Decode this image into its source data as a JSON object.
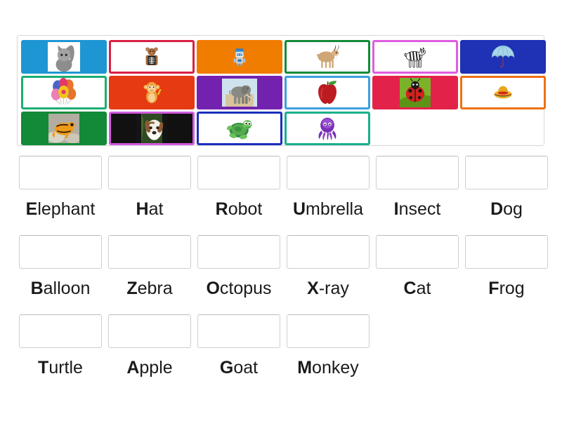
{
  "activity": {
    "type": "match-up",
    "title": "Alphabet picture and word match-up"
  },
  "image_tray": {
    "rows": [
      [
        {
          "id": "cat",
          "label": "cat picture",
          "bg": "#1e96d4",
          "border": "#1e96d4",
          "art": "cat",
          "art_bg": "#ffffff",
          "art_w": 46,
          "art_h": 48
        },
        {
          "id": "xray",
          "label": "x-ray picture",
          "bg": "#ffffff",
          "border": "#d91f45",
          "art": "xray",
          "art_bg": "#ffffff",
          "art_w": 30,
          "art_h": 44
        },
        {
          "id": "robot",
          "label": "robot picture",
          "bg": "#f07c00",
          "border": "#f07c00",
          "art": "robot",
          "art_bg": "#f07c00",
          "art_w": 28,
          "art_h": 42
        },
        {
          "id": "goat",
          "label": "goat picture",
          "bg": "#ffffff",
          "border": "#128a38",
          "art": "goat",
          "art_bg": "#ffffff",
          "art_w": 48,
          "art_h": 40
        },
        {
          "id": "zebra",
          "label": "zebra picture",
          "bg": "#ffffff",
          "border": "#e05ce0",
          "art": "zebra",
          "art_bg": "#ffffff",
          "art_w": 48,
          "art_h": 38
        },
        {
          "id": "umbrella",
          "label": "umbrella picture",
          "bg": "#1f31b4",
          "border": "#1f31b4",
          "art": "umbrella",
          "art_bg": "#1f31b4",
          "art_w": 56,
          "art_h": 36
        }
      ],
      [
        {
          "id": "balloon",
          "label": "balloon picture",
          "bg": "#ffffff",
          "border": "#1bae74",
          "art": "balloon",
          "art_bg": "#ffffff",
          "art_w": 44,
          "art_h": 44
        },
        {
          "id": "monkey",
          "label": "monkey picture",
          "bg": "#e53a12",
          "border": "#e53a12",
          "art": "monkey",
          "art_bg": "#e53a12",
          "art_w": 36,
          "art_h": 42
        },
        {
          "id": "elephant",
          "label": "elephant picture",
          "bg": "#7322b0",
          "border": "#7322b0",
          "art": "elephant",
          "art_bg": "#cfe3ef",
          "art_w": 50,
          "art_h": 40
        },
        {
          "id": "apple",
          "label": "apple picture",
          "bg": "#ffffff",
          "border": "#3aa0df",
          "art": "apple",
          "art_bg": "#ffffff",
          "art_w": 38,
          "art_h": 42
        },
        {
          "id": "insect",
          "label": "insect picture",
          "bg": "#e3224a",
          "border": "#e3224a",
          "art": "insect",
          "art_bg": "#6ea81f",
          "art_w": 44,
          "art_h": 44
        },
        {
          "id": "hat",
          "label": "hat picture",
          "bg": "#ffffff",
          "border": "#ec7211",
          "art": "hat",
          "art_bg": "#ffffff",
          "art_w": 50,
          "art_h": 26
        }
      ],
      [
        {
          "id": "frog",
          "label": "frog picture",
          "bg": "#128a38",
          "border": "#128a38",
          "art": "frog",
          "art_bg": "#9a9a8a",
          "art_w": 44,
          "art_h": 44
        },
        {
          "id": "dog",
          "label": "dog picture",
          "bg": "#111111",
          "border": "#d45be0",
          "art": "dog",
          "art_bg": "#111111",
          "art_w": 54,
          "art_h": 44
        },
        {
          "id": "turtle",
          "label": "turtle picture",
          "bg": "#ffffff",
          "border": "#1b2fbe",
          "art": "turtle",
          "art_bg": "#ffffff",
          "art_w": 50,
          "art_h": 40
        },
        {
          "id": "octopus",
          "label": "octopus picture",
          "bg": "#ffffff",
          "border": "#18b08c",
          "art": "octopus",
          "art_bg": "#ffffff",
          "art_w": 38,
          "art_h": 40
        }
      ]
    ]
  },
  "word_rows": [
    [
      {
        "first": "E",
        "rest": "lephant",
        "word": "Elephant"
      },
      {
        "first": "H",
        "rest": "at",
        "word": "Hat"
      },
      {
        "first": "R",
        "rest": "obot",
        "word": "Robot"
      },
      {
        "first": "U",
        "rest": "mbrella",
        "word": "Umbrella"
      },
      {
        "first": "I",
        "rest": "nsect",
        "word": "Insect"
      },
      {
        "first": "D",
        "rest": "og",
        "word": "Dog"
      }
    ],
    [
      {
        "first": "B",
        "rest": "alloon",
        "word": "Balloon"
      },
      {
        "first": "Z",
        "rest": "ebra",
        "word": "Zebra"
      },
      {
        "first": "O",
        "rest": "ctopus",
        "word": "Octopus"
      },
      {
        "first": "X",
        "rest": "-ray",
        "word": "X-ray"
      },
      {
        "first": "C",
        "rest": "at",
        "word": "Cat"
      },
      {
        "first": "F",
        "rest": "rog",
        "word": "Frog"
      }
    ],
    [
      {
        "first": "T",
        "rest": "urtle",
        "word": "Turtle"
      },
      {
        "first": "A",
        "rest": "pple",
        "word": "Apple"
      },
      {
        "first": "G",
        "rest": "oat",
        "word": "Goat"
      },
      {
        "first": "M",
        "rest": "onkey",
        "word": "Monkey"
      }
    ]
  ],
  "colors": {
    "page_bg": "#ffffff",
    "tray_border": "#d8d8d8",
    "dropzone_border": "#cfcfcf",
    "word_text": "#1a1a1a"
  }
}
